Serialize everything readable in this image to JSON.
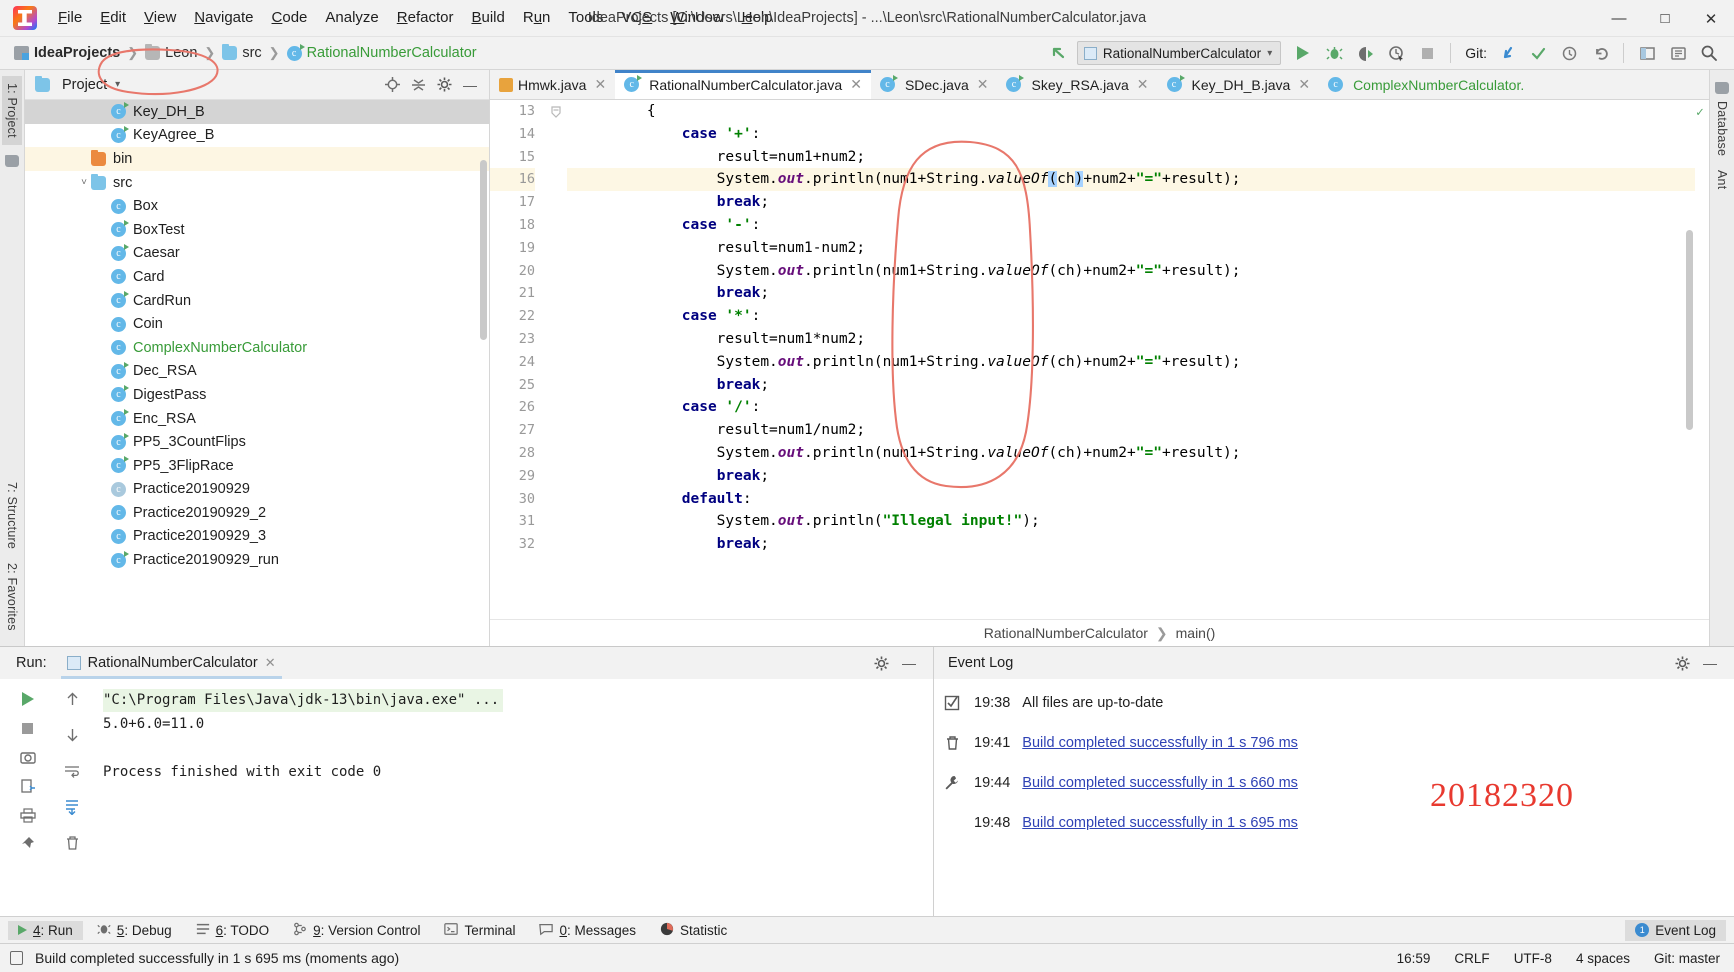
{
  "window": {
    "title": "IdeaProjects [C:\\Users\\Leon\\IdeaProjects] - ...\\Leon\\src\\RationalNumberCalculator.java",
    "minimize": "—",
    "maximize": "□",
    "close": "✕"
  },
  "menu": [
    {
      "label": "File"
    },
    {
      "label": "Edit"
    },
    {
      "label": "View"
    },
    {
      "label": "Navigate"
    },
    {
      "label": "Code"
    },
    {
      "label": "Analyze"
    },
    {
      "label": "Refactor"
    },
    {
      "label": "Build"
    },
    {
      "label": "Run"
    },
    {
      "label": "Tools"
    },
    {
      "label": "VCS"
    },
    {
      "label": "Window"
    },
    {
      "label": "Help"
    }
  ],
  "breadcrumbs": [
    {
      "label": "IdeaProjects",
      "icon": "project-icon",
      "bold": true
    },
    {
      "label": "Leon",
      "icon": "folder-icon-grey"
    },
    {
      "label": "src",
      "icon": "folder-icon"
    },
    {
      "label": "RationalNumberCalculator",
      "icon": "class-icon",
      "green": true
    }
  ],
  "toolbar": {
    "back_icon": "back-arrow-icon",
    "run_config": "RationalNumberCalculator",
    "run_icon": "run-icon",
    "debug_icon": "debug-icon",
    "run_coverage_icon": "run-with-coverage-icon",
    "profile_icon": "profiler-icon",
    "stop_icon": "stop-icon",
    "git_label": "Git:",
    "git_update_icon": "update-project-icon",
    "git_commit_icon": "commit-icon",
    "git_history_icon": "history-icon",
    "undo_icon": "undo-icon",
    "layout_icon": "layout-icon",
    "settings_icon": "settings-icon",
    "search_icon": "search-icon"
  },
  "left_rail": [
    {
      "label": "1: Project",
      "active": true
    },
    {
      "label": "structure-icon"
    }
  ],
  "left_rail_bottom": [
    {
      "label": "7: Structure"
    },
    {
      "label": "2: Favorites"
    }
  ],
  "right_rail": [
    {
      "label": "Database"
    },
    {
      "label": "Ant"
    }
  ],
  "sidebar": {
    "title": "Project",
    "dropdown_icon": "chevron-down-icon",
    "actions": [
      "locate-icon",
      "collapse-all-icon",
      "gear-icon",
      "hide-icon"
    ],
    "tree": [
      {
        "label": "Key_DH_B",
        "indent": 3,
        "icon": "class-runnable",
        "state": "selected"
      },
      {
        "label": "KeyAgree_B",
        "indent": 3,
        "icon": "class-runnable"
      },
      {
        "label": "bin",
        "indent": 2,
        "icon": "folder-orange",
        "state": "highlight"
      },
      {
        "label": "src",
        "indent": 2,
        "icon": "folder-blue",
        "twisty": "˅"
      },
      {
        "label": "Box",
        "indent": 3,
        "icon": "class"
      },
      {
        "label": "BoxTest",
        "indent": 3,
        "icon": "class-runnable"
      },
      {
        "label": "Caesar",
        "indent": 3,
        "icon": "class-runnable"
      },
      {
        "label": "Card",
        "indent": 3,
        "icon": "class"
      },
      {
        "label": "CardRun",
        "indent": 3,
        "icon": "class-runnable"
      },
      {
        "label": "Coin",
        "indent": 3,
        "icon": "class"
      },
      {
        "label": "ComplexNumberCalculator",
        "indent": 3,
        "icon": "class",
        "green": true
      },
      {
        "label": "Dec_RSA",
        "indent": 3,
        "icon": "class-runnable"
      },
      {
        "label": "DigestPass",
        "indent": 3,
        "icon": "class-runnable"
      },
      {
        "label": "Enc_RSA",
        "indent": 3,
        "icon": "class-runnable"
      },
      {
        "label": "PP5_3CountFlips",
        "indent": 3,
        "icon": "class-runnable"
      },
      {
        "label": "PP5_3FlipRace",
        "indent": 3,
        "icon": "class-runnable"
      },
      {
        "label": "Practice20190929",
        "indent": 3,
        "icon": "class-grey"
      },
      {
        "label": "Practice20190929_2",
        "indent": 3,
        "icon": "class"
      },
      {
        "label": "Practice20190929_3",
        "indent": 3,
        "icon": "class"
      },
      {
        "label": "Practice20190929_run",
        "indent": 3,
        "icon": "class-runnable"
      }
    ]
  },
  "editor": {
    "tabs": [
      {
        "label": "Hmwk.java",
        "icon": "java-file-icon",
        "active": false
      },
      {
        "label": "RationalNumberCalculator.java",
        "icon": "class-runnable",
        "active": true
      },
      {
        "label": "SDec.java",
        "icon": "class-runnable",
        "active": false
      },
      {
        "label": "Skey_RSA.java",
        "icon": "class-runnable",
        "active": false
      },
      {
        "label": "Key_DH_B.java",
        "icon": "class-runnable",
        "active": false
      },
      {
        "label": "ComplexNumberCalculator.",
        "icon": "class",
        "active": false,
        "green": true
      }
    ],
    "first_line_number": 13,
    "highlight_line": 16,
    "lines": [
      {
        "n": 13,
        "indent": 4,
        "text": "{"
      },
      {
        "n": 14,
        "indent": 6,
        "text": "case '+':"
      },
      {
        "n": 15,
        "indent": 8,
        "text": "result=num1+num2;"
      },
      {
        "n": 16,
        "indent": 8,
        "text": "System.out.println(num1+String.valueOf(ch)+num2+\"=\"+result);"
      },
      {
        "n": 17,
        "indent": 8,
        "text": "break;"
      },
      {
        "n": 18,
        "indent": 6,
        "text": "case '-':"
      },
      {
        "n": 19,
        "indent": 8,
        "text": "result=num1-num2;"
      },
      {
        "n": 20,
        "indent": 8,
        "text": "System.out.println(num1+String.valueOf(ch)+num2+\"=\"+result);"
      },
      {
        "n": 21,
        "indent": 8,
        "text": "break;"
      },
      {
        "n": 22,
        "indent": 6,
        "text": "case '*':"
      },
      {
        "n": 23,
        "indent": 8,
        "text": "result=num1*num2;"
      },
      {
        "n": 24,
        "indent": 8,
        "text": "System.out.println(num1+String.valueOf(ch)+num2+\"=\"+result);"
      },
      {
        "n": 25,
        "indent": 8,
        "text": "break;"
      },
      {
        "n": 26,
        "indent": 6,
        "text": "case '/':"
      },
      {
        "n": 27,
        "indent": 8,
        "text": "result=num1/num2;"
      },
      {
        "n": 28,
        "indent": 8,
        "text": "System.out.println(num1+String.valueOf(ch)+num2+\"=\"+result);"
      },
      {
        "n": 29,
        "indent": 8,
        "text": "break;"
      },
      {
        "n": 30,
        "indent": 6,
        "text": "default:"
      },
      {
        "n": 31,
        "indent": 8,
        "text": "System.out.println(\"Illegal input!\");"
      },
      {
        "n": 32,
        "indent": 8,
        "text": "break;"
      }
    ],
    "breadcrumb": [
      "RationalNumberCalculator",
      "main()"
    ],
    "inspection_status": "ok-check-icon"
  },
  "run_panel": {
    "title": "Run:",
    "tab_label": "RationalNumberCalculator",
    "tab_close": "✕",
    "gear_icon": "gear-icon",
    "minimize_icon": "minimize-icon",
    "side_buttons": [
      "rerun-icon",
      "up-icon",
      "stop-icon",
      "down-icon",
      "camera-icon",
      "wrap-icon",
      "export-icon",
      "scroll-end-icon",
      "print-icon",
      "trash-icon"
    ],
    "console": [
      {
        "text": "\"C:\\Program Files\\Java\\jdk-13\\bin\\java.exe\" ...",
        "style": "cmd"
      },
      {
        "text": "5.0+6.0=11.0",
        "style": "out"
      },
      {
        "text": "",
        "style": "out"
      },
      {
        "text": "Process finished with exit code 0",
        "style": "out"
      }
    ]
  },
  "event_log": {
    "title": "Event Log",
    "gear_icon": "gear-icon",
    "minimize_icon": "minimize-icon",
    "side_buttons": [
      "mark-read-icon",
      "trash-icon",
      "settings-wrench-icon"
    ],
    "entries": [
      {
        "time": "19:38",
        "message": "All files are up-to-date",
        "link": false
      },
      {
        "time": "19:41",
        "message": "Build completed successfully in 1 s 796 ms",
        "link": true
      },
      {
        "time": "19:44",
        "message": "Build completed successfully in 1 s 660 ms",
        "link": true
      },
      {
        "time": "19:48",
        "message": "Build completed successfully in 1 s 695 ms",
        "link": true
      }
    ],
    "annotation_number": "20182320"
  },
  "toolwindow_bar": [
    {
      "label": "4: Run",
      "icon": "run-icon",
      "active": true
    },
    {
      "label": "5: Debug",
      "icon": "debug-icon"
    },
    {
      "label": "6: TODO",
      "icon": "todo-icon"
    },
    {
      "label": "9: Version Control",
      "icon": "vcs-icon"
    },
    {
      "label": "Terminal",
      "icon": "terminal-icon"
    },
    {
      "label": "0: Messages",
      "icon": "messages-icon"
    },
    {
      "label": "Statistic",
      "icon": "statistic-icon"
    }
  ],
  "event_log_chip": {
    "label": "Event Log",
    "badge": "1"
  },
  "statusbar": {
    "message": "Build completed successfully in 1 s 695 ms (moments ago)",
    "lock_icon": "lock-icon",
    "time": "16:59",
    "line_ending": "CRLF",
    "encoding": "UTF-8",
    "indent": "4 spaces",
    "git_branch": "Git: master"
  },
  "colors": {
    "accent_blue": "#4083c9",
    "green": "#389b38",
    "annotation_red": "#e8392f",
    "link_blue": "#2f42b5"
  }
}
